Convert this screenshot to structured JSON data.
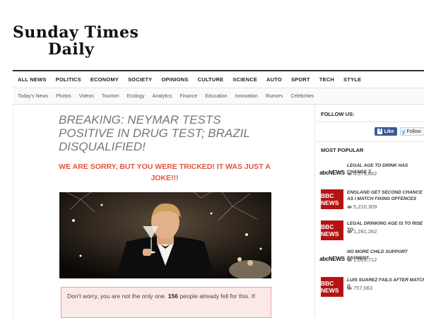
{
  "logo": {
    "line1": "Sunday Times",
    "line2": "Daily"
  },
  "topnav": [
    "ALL NEWS",
    "POLITICS",
    "ECONOMY",
    "SOCIETY",
    "OPINIONS",
    "CULTURE",
    "SCIENCE",
    "AUTO",
    "SPORT",
    "TECH",
    "STYLE"
  ],
  "subnav": [
    "Today's News",
    "Photos",
    "Videos",
    "Tourism",
    "Ecology",
    "Analytics",
    "Finance",
    "Education",
    "Innovation",
    "Rumors",
    "Celebrities"
  ],
  "article": {
    "headline": "BREAKING: NEYMAR TESTS POSITIVE IN DRUG TEST; BRAZIL DISQUALIFIED!",
    "sorry": "WE ARE SORRY, BUT YOU WERE TRICKED! IT WAS JUST A JOKE!!!",
    "notice_pre": "Don't worry, you are not the only one.",
    "notice_count": "156",
    "notice_post": "people already fell for this. If"
  },
  "sidebar": {
    "follow_us": "FOLLOW US:",
    "fb_like": "Like",
    "tw_follow": "Follow",
    "most_popular": "MOST POPULAR",
    "items": [
      {
        "source": "abcNEWS",
        "title": "LEGAL AGE TO DRINK HAS CHANGE T",
        "views": "8,079,862"
      },
      {
        "source": "BBC NEWS",
        "title": "ENGLAND GET SECOND CHANCE AS I MATCH FIXING OFFENCES",
        "views": "5,210,309"
      },
      {
        "source": "BBC NEWS",
        "title": "LEGAL DRINKING AGE IS TO RISE TO",
        "views": "1,281,262"
      },
      {
        "source": "abcNEWS",
        "title": "NO MORE CHILD SUPPORT PAYMENT",
        "views": "1,003,712"
      },
      {
        "source": "BBC NEWS",
        "title": "LUIS SUAREZ FAILS AFTER MATCH D",
        "views": "757,063"
      }
    ]
  }
}
